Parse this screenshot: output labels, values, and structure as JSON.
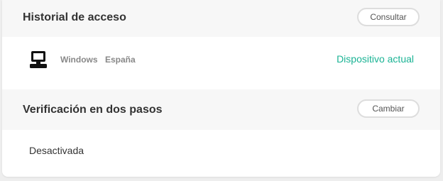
{
  "access_history": {
    "title": "Historial de acceso",
    "button_label": "Consultar",
    "device": {
      "icon": "computer-icon",
      "os": "Windows",
      "country": "España",
      "status": "Dispositivo actual"
    }
  },
  "two_step": {
    "title": "Verificación en dos pasos",
    "button_label": "Cambiar",
    "status": "Desactivada"
  },
  "colors": {
    "accent": "#1ab394",
    "header_bg": "#f7f7f7"
  }
}
